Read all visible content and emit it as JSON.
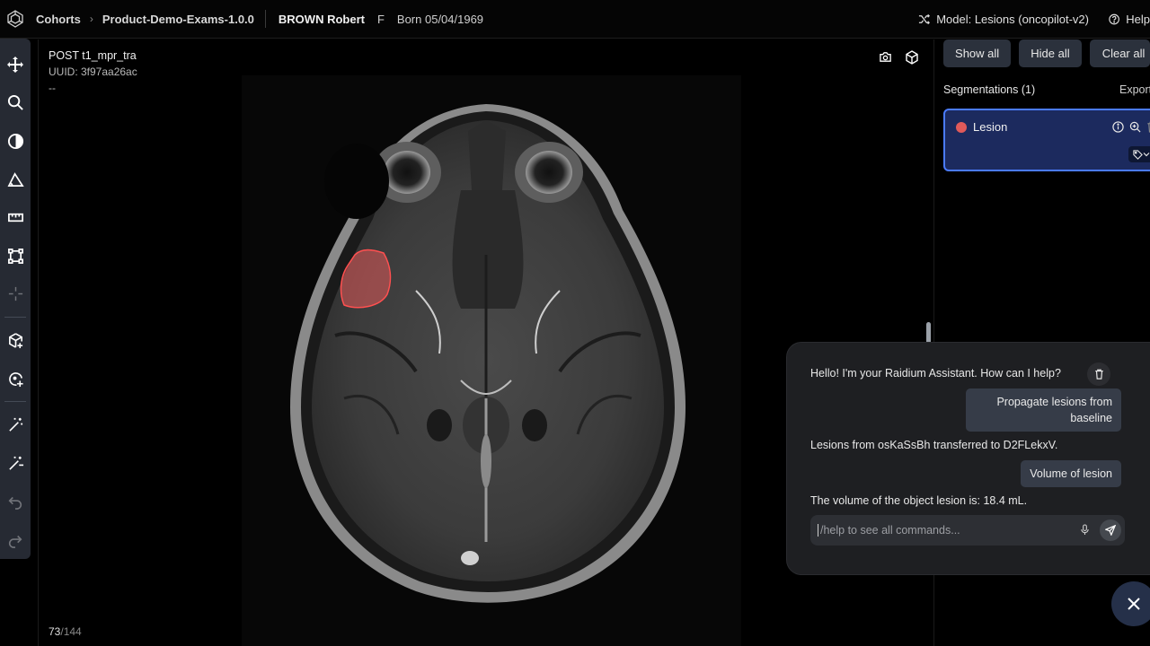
{
  "header": {
    "breadcrumb": [
      "Cohorts",
      "Product-Demo-Exams-1.0.0"
    ],
    "patient_name": "BROWN Robert",
    "patient_sex": "F",
    "patient_born": "Born 05/04/1969",
    "model_label": "Model: Lesions (oncopilot-v2)",
    "help_label": "Help"
  },
  "toolbar": {
    "icons": [
      "move-icon",
      "zoom-icon",
      "contrast-icon",
      "angle-icon",
      "ruler-icon",
      "bounding-box-icon",
      "crosshair-icon",
      "3d-cube-add-icon",
      "segment-add-icon",
      "magic-wand-icon",
      "magic-wand-remove-icon",
      "undo-icon",
      "redo-icon"
    ]
  },
  "viewport": {
    "series_name": "POST t1_mpr_tra",
    "uuid": "UUID: 3f97aa26ac",
    "extra": "--",
    "slice_current": "73",
    "slice_total": "/144"
  },
  "panel": {
    "show_all": "Show all",
    "hide_all": "Hide all",
    "clear_all": "Clear all",
    "segmentations_title": "Segmentations (1)",
    "export_label": "Export",
    "segments": [
      {
        "label": "Lesion",
        "color": "#e05a5a"
      }
    ]
  },
  "chat": {
    "greeting": "Hello! I'm your Raidium Assistant. How can I help?",
    "user_msg_1_line1": "Propagate lesions from",
    "user_msg_1_line2": "baseline",
    "bot_msg_1": "Lesions from osKaSsBh transferred to D2FLekxV.",
    "user_msg_2": "Volume of lesion",
    "bot_msg_2": "The volume of the object lesion is: 18.4 mL.",
    "input_placeholder": "/help to see all commands..."
  },
  "colors": {
    "accent": "#4a7bff",
    "lesion": "#e05a5a",
    "toolbar_bg": "#262a33"
  }
}
